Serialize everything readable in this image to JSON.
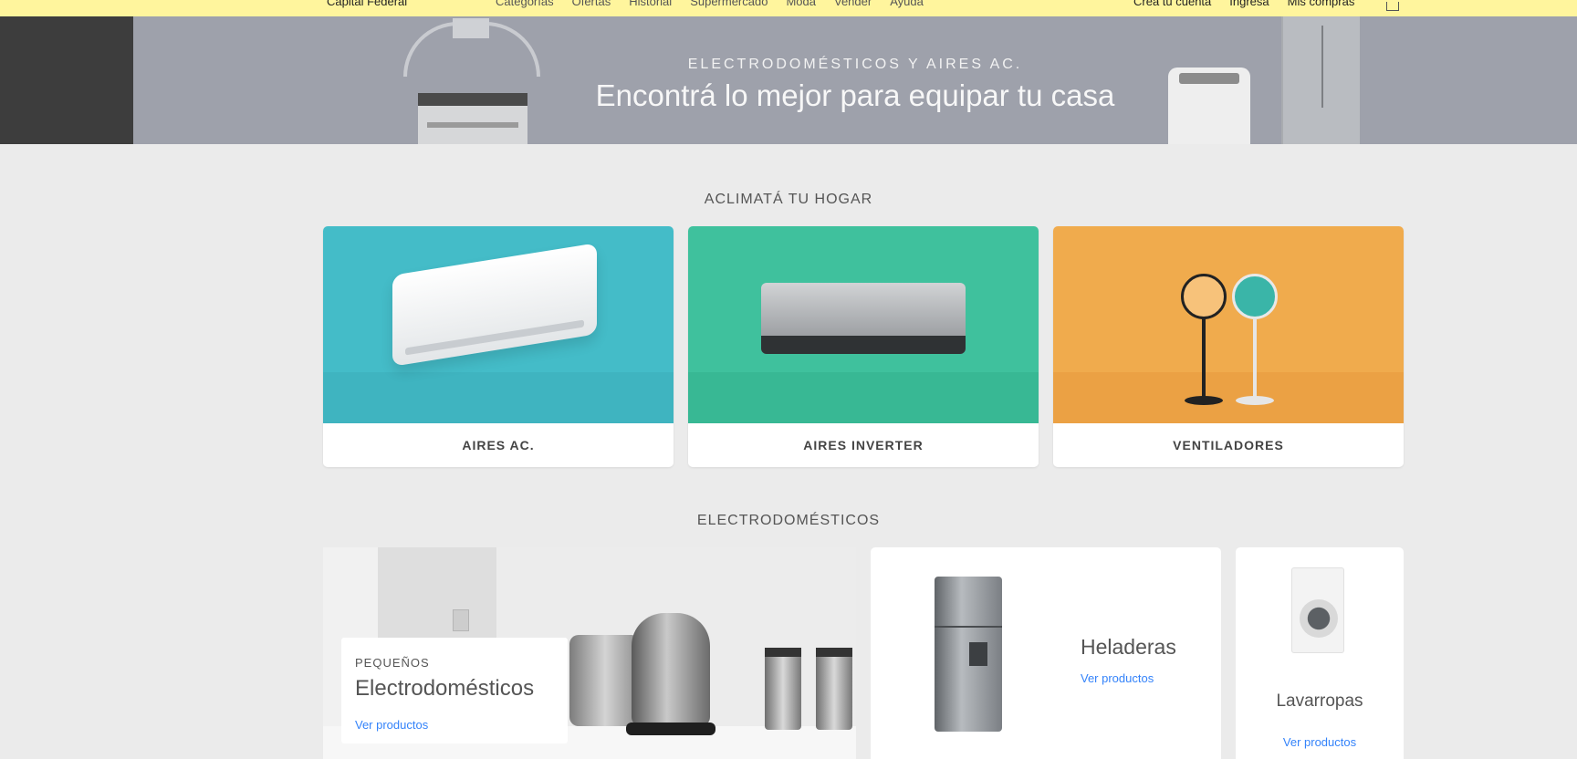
{
  "topbar": {
    "location": "Capital Federal",
    "nav": [
      "Categorías",
      "Ofertas",
      "Historial",
      "Supermercado",
      "Moda",
      "Vender",
      "Ayuda"
    ],
    "account": [
      "Creá tu cuenta",
      "Ingresá",
      "Mis compras"
    ],
    "cart_icon": "cart-icon",
    "bg_color": "#fff59d"
  },
  "hero": {
    "eyebrow": "ELECTRODOMÉSTICOS Y AIRES AC.",
    "headline": "Encontrá lo mejor para equipar tu casa"
  },
  "section_climate": {
    "title": "ACLIMATÁ TU HOGAR",
    "cards": [
      {
        "label": "AIRES AC.",
        "bg": "#44bcc8"
      },
      {
        "label": "AIRES INVERTER",
        "bg": "#3fc19d"
      },
      {
        "label": "VENTILADORES",
        "bg": "#f0ab4d"
      }
    ]
  },
  "section_appliances": {
    "title": "ELECTRODOMÉSTICOS",
    "featured": {
      "kicker": "PEQUEÑOS",
      "title": "Electrodomésticos",
      "link": "Ver productos"
    },
    "fridges": {
      "title": "Heladeras",
      "link": "Ver productos"
    },
    "washers": {
      "title": "Lavarropas",
      "link": "Ver productos"
    }
  },
  "link_color": "#3483fa"
}
